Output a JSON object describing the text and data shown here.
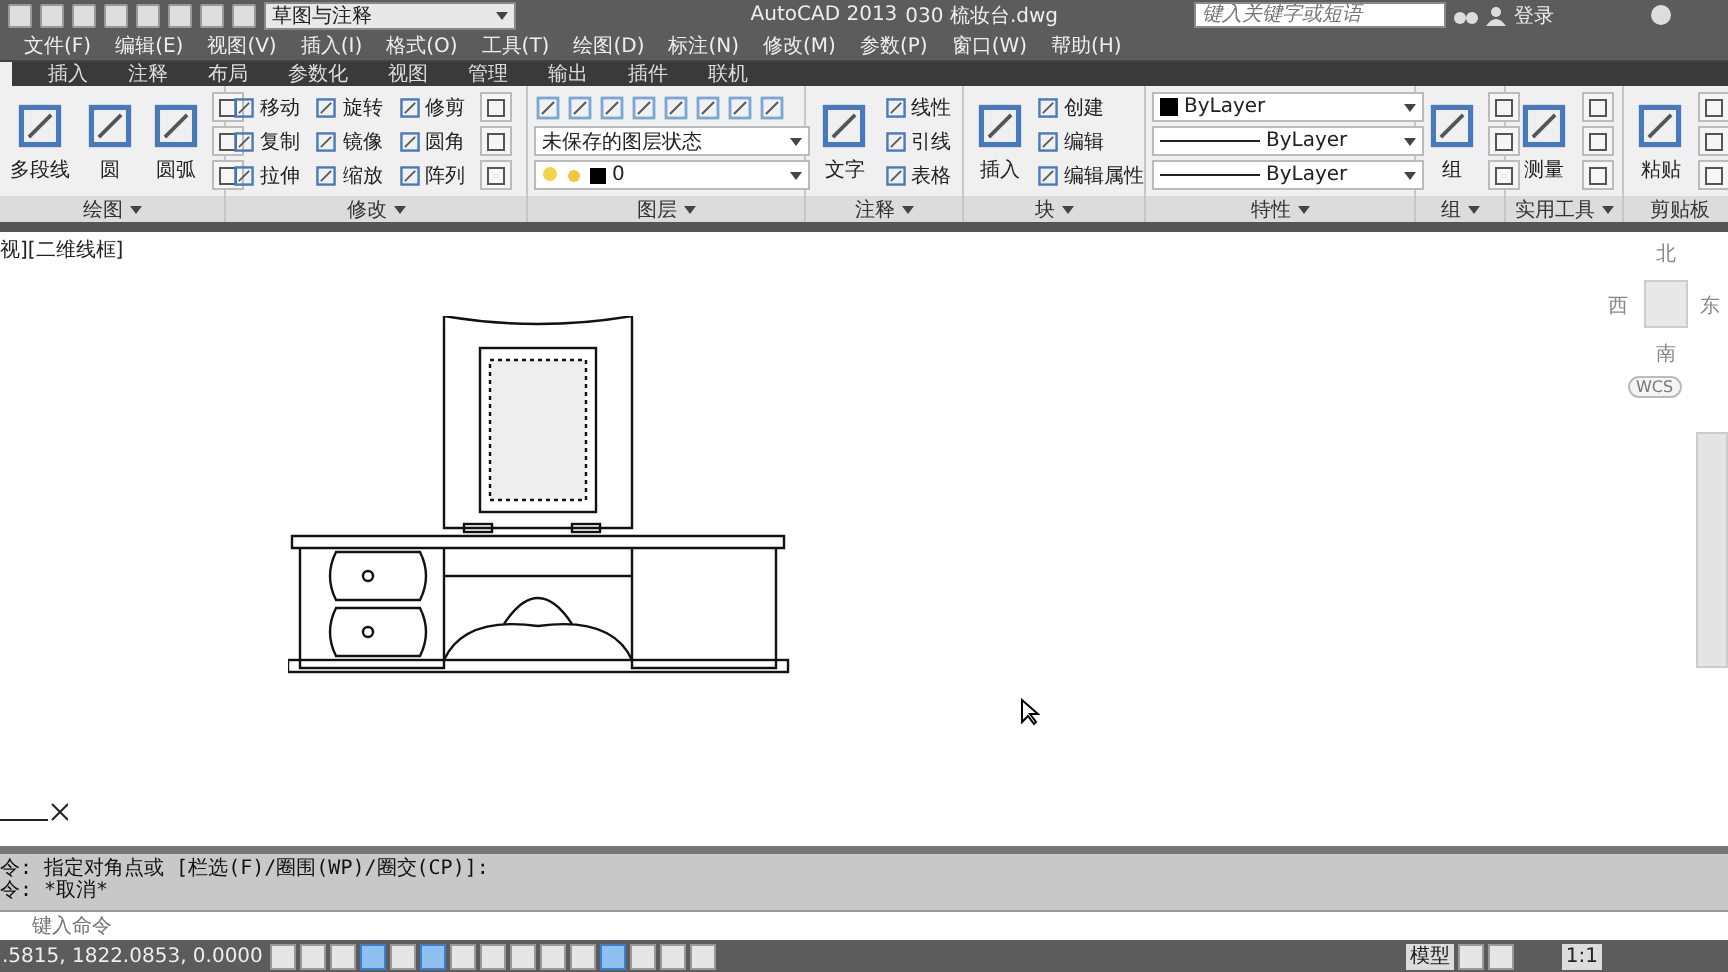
{
  "title_bar": {
    "workspace": "草图与注释",
    "app": "AutoCAD 2013",
    "file": "030 梳妆台.dwg",
    "search": {
      "placeholder": "键入关键字或短语"
    },
    "sign_in": "登录"
  },
  "menu": [
    "文件(F)",
    "编辑(E)",
    "视图(V)",
    "插入(I)",
    "格式(O)",
    "工具(T)",
    "绘图(D)",
    "标注(N)",
    "修改(M)",
    "参数(P)",
    "窗口(W)",
    "帮助(H)"
  ],
  "ribbon_tabs": [
    {
      "label": "插入",
      "selected": false
    },
    {
      "label": "注释",
      "selected": false
    },
    {
      "label": "布局",
      "selected": false
    },
    {
      "label": "参数化",
      "selected": false
    },
    {
      "label": "视图",
      "selected": false
    },
    {
      "label": "管理",
      "selected": false
    },
    {
      "label": "输出",
      "selected": false
    },
    {
      "label": "插件",
      "selected": false
    },
    {
      "label": "联机",
      "selected": false
    }
  ],
  "panels": [
    {
      "title": "绘图",
      "has_menu": true,
      "tools": [
        {
          "kind": "large",
          "label": "多段线"
        },
        {
          "kind": "large",
          "label": "圆"
        },
        {
          "kind": "large",
          "label": "圆弧"
        },
        {
          "kind": "icon"
        },
        {
          "kind": "icon"
        },
        {
          "kind": "icon"
        }
      ]
    },
    {
      "title": "修改",
      "has_menu": true,
      "tools": [
        {
          "kind": "small",
          "label": "移动"
        },
        {
          "kind": "small",
          "label": "复制"
        },
        {
          "kind": "small",
          "label": "拉伸"
        },
        {
          "kind": "small",
          "label": "旋转"
        },
        {
          "kind": "small",
          "label": "镜像"
        },
        {
          "kind": "small",
          "label": "缩放"
        },
        {
          "kind": "small",
          "label": "修剪"
        },
        {
          "kind": "small",
          "label": "圆角"
        },
        {
          "kind": "small",
          "label": "阵列"
        },
        {
          "kind": "icon"
        },
        {
          "kind": "icon"
        },
        {
          "kind": "icon"
        }
      ]
    },
    {
      "title": "图层",
      "has_menu": true,
      "tools": [
        {
          "kind": "iconrow"
        },
        {
          "kind": "dropdown",
          "value": "未保存的图层状态"
        },
        {
          "kind": "layer",
          "value": "0"
        }
      ]
    },
    {
      "title": "注释",
      "has_menu": true,
      "tools": [
        {
          "kind": "large",
          "label": "文字"
        },
        {
          "kind": "small",
          "label": "线性"
        },
        {
          "kind": "small",
          "label": "引线"
        },
        {
          "kind": "small",
          "label": "表格"
        }
      ]
    },
    {
      "title": "块",
      "has_menu": true,
      "tools": [
        {
          "kind": "large",
          "label": "插入"
        },
        {
          "kind": "small",
          "label": "创建"
        },
        {
          "kind": "small",
          "label": "编辑"
        },
        {
          "kind": "small",
          "label": "编辑属性"
        }
      ]
    },
    {
      "title": "特性",
      "has_menu": true,
      "tools": [
        {
          "kind": "swatch",
          "value": "ByLayer"
        },
        {
          "kind": "line",
          "value": "ByLayer"
        },
        {
          "kind": "line",
          "value": "ByLayer"
        }
      ]
    },
    {
      "title": "组",
      "has_menu": true,
      "tools": [
        {
          "kind": "large",
          "label": "组"
        },
        {
          "kind": "icon"
        },
        {
          "kind": "icon"
        },
        {
          "kind": "icon"
        }
      ]
    },
    {
      "title": "实用工具",
      "has_menu": true,
      "tools": [
        {
          "kind": "large",
          "label": "测量"
        },
        {
          "kind": "icon"
        },
        {
          "kind": "icon"
        },
        {
          "kind": "icon"
        }
      ]
    },
    {
      "title": "剪贴板",
      "has_menu": false,
      "tools": [
        {
          "kind": "large",
          "label": "粘贴"
        },
        {
          "kind": "icon"
        },
        {
          "kind": "icon"
        },
        {
          "kind": "icon"
        }
      ]
    }
  ],
  "viewport_label": "视][二维线框]",
  "view_cube": {
    "north": "北",
    "west": "西",
    "east": "东",
    "south": "南",
    "wcs": "WCS"
  },
  "command": {
    "history": [
      "令: 指定对角点或 [栏选(F)/圈围(WP)/圈交(CP)]:",
      "令: *取消*"
    ],
    "placeholder": "键入命令"
  },
  "status_bar": {
    "coordinates": ".5815, 1822.0853, 0.0000",
    "toggles": [
      {
        "on": false
      },
      {
        "on": false
      },
      {
        "on": false
      },
      {
        "on": true
      },
      {
        "on": false
      },
      {
        "on": true
      },
      {
        "on": false
      },
      {
        "on": false
      },
      {
        "on": false
      },
      {
        "on": false
      },
      {
        "on": false
      },
      {
        "on": true
      },
      {
        "on": false
      },
      {
        "on": false
      },
      {
        "on": false
      }
    ],
    "model": "模型",
    "scale": "1:1"
  }
}
